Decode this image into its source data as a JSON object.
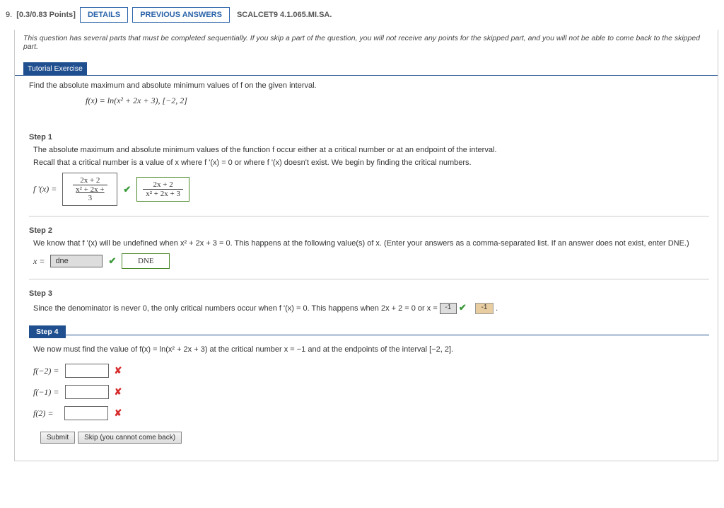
{
  "header": {
    "qnum": "9.",
    "points": "[0.3/0.83 Points]",
    "details_btn": "DETAILS",
    "prev_btn": "PREVIOUS ANSWERS",
    "ref": "SCALCET9 4.1.065.MI.SA."
  },
  "note": "This question has several parts that must be completed sequentially. If you skip a part of the question, you will not receive any points for the skipped part, and you will not be able to come back to the skipped part.",
  "tutorial_label": "Tutorial Exercise",
  "tutorial_body": {
    "line1": "Find the absolute maximum and absolute minimum values of f on the given interval.",
    "eq": "f(x) = ln(x² + 2x + 3),   [−2, 2]"
  },
  "step1": {
    "title": "Step 1",
    "p1": "The absolute maximum and absolute minimum values of the function f occur either at a critical number or at an endpoint of the interval.",
    "p2": "Recall that a critical number is a value of x where f '(x) = 0 or where f '(x) doesn't exist. We begin by finding the critical numbers.",
    "lhs": "f '(x) = ",
    "input_num": "2x + 2",
    "input_den": "x² + 2x + 3",
    "answer_num": "2x + 2",
    "answer_den": "x² + 2x + 3"
  },
  "step2": {
    "title": "Step 2",
    "p1a": "We know that f '(x) will be undefined when x² + 2x + 3 = 0. This happens at the following value(s) of x. (Enter your answers as a comma-separated list. If an answer does not exist, enter DNE.)",
    "lhs": "x = ",
    "input_val": "dne",
    "correct_val": "DNE"
  },
  "step3": {
    "title": "Step 3",
    "p1": "Since the denominator is never 0, the only critical numbers occur when f '(x) = 0. This happens when 2x + 2 = 0 or x = ",
    "input_val": "-1",
    "correct_val": "-1"
  },
  "step4": {
    "title": "Step 4",
    "p1": "We now must find the value of f(x) = ln(x² + 2x + 3) at the critical number x = −1 and at the endpoints of the interval [−2, 2].",
    "row1": "f(−2) = ",
    "row2": "f(−1) = ",
    "row3": "f(2) = "
  },
  "submit": {
    "submit_btn": "Submit",
    "skip_btn": "Skip (you cannot come back)"
  }
}
